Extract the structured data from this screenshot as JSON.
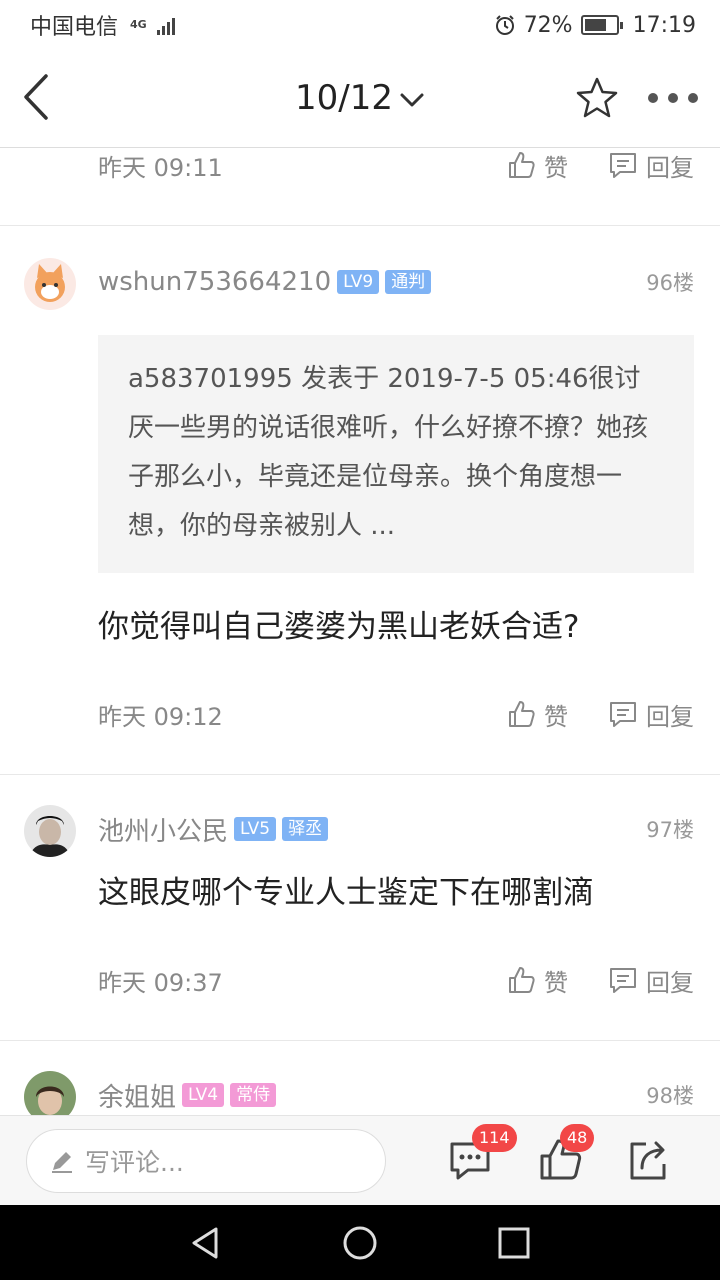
{
  "status_bar": {
    "carrier": "中国电信",
    "network": "4G",
    "battery": "72%",
    "battery_level": 0.72,
    "time": "17:19"
  },
  "nav": {
    "page_indicator": "10/12"
  },
  "items": [
    {
      "time": "昨天 09:11",
      "like_label": "赞",
      "reply_label": "回复"
    },
    {
      "username": "wshun753664210",
      "level": "LV9",
      "title_badge": "通判",
      "badge_color": "#7fb3f5",
      "floor": "96楼",
      "quote": "a583701995 发表于 2019-7-5 05:46很讨厌一些男的说话很难听，什么好撩不撩？她孩子那么小，毕竟还是位母亲。换个角度想一想，你的母亲被别人 ...",
      "content": "你觉得叫自己婆婆为黑山老妖合适?",
      "time": "昨天 09:12",
      "like_label": "赞",
      "reply_label": "回复"
    },
    {
      "username": "池州小公民",
      "level": "LV5",
      "title_badge": "驿丞",
      "badge_color": "#7fb3f5",
      "floor": "97楼",
      "content": "这眼皮哪个专业人士鉴定下在哪割滴",
      "time": "昨天 09:37",
      "like_label": "赞",
      "reply_label": "回复"
    },
    {
      "username": "余姐姐",
      "level": "LV4",
      "title_badge": "常侍",
      "badge_color": "#f39ad6",
      "floor": "98楼"
    }
  ],
  "comment_bar": {
    "placeholder": "写评论...",
    "comment_count": "114",
    "like_count": "48"
  }
}
